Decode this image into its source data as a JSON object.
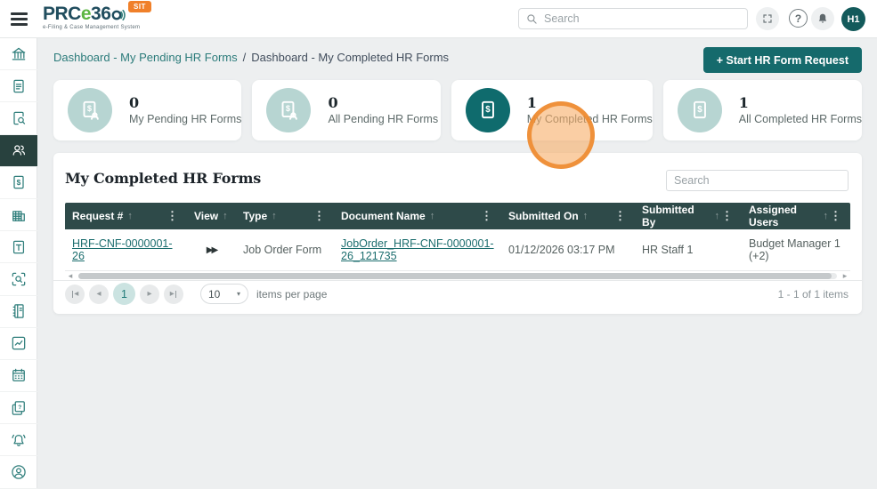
{
  "header": {
    "logo": {
      "prc": "PRC",
      "e": "e",
      "num": "36",
      "tagline": "e-Filing & Case Management System",
      "badge": "SIT"
    },
    "search_placeholder": "Search",
    "avatar": "H1"
  },
  "breadcrumb": {
    "link": "Dashboard - My Pending HR Forms",
    "separator": "/",
    "current": "Dashboard - My Completed HR Forms"
  },
  "toolbar": {
    "start_button": "+ Start HR Form Request"
  },
  "stats": [
    {
      "value": "0",
      "label": "My Pending HR Forms"
    },
    {
      "value": "0",
      "label": "All Pending HR Forms"
    },
    {
      "value": "1",
      "label": "My Completed HR Forms"
    },
    {
      "value": "1",
      "label": "All Completed HR Forms"
    }
  ],
  "panel": {
    "title": "My Completed HR Forms",
    "search_placeholder": "Search",
    "columns": [
      "Request #",
      "View",
      "Type",
      "Document Name",
      "Submitted On",
      "Submitted By",
      "Assigned Users"
    ],
    "row": {
      "request_id": "HRF-CNF-0000001-26",
      "type": "Job Order Form",
      "document_name": "JobOrder_HRF-CNF-0000001-26_121735",
      "submitted_on": "01/12/2026 03:17 PM",
      "submitted_by": "HR Staff 1",
      "assigned_users": "Budget Manager 1 (+2)"
    },
    "pagination": {
      "page": "1",
      "page_size": "10",
      "items_per_page": "items per page",
      "range": "1 - 1 of 1 items"
    }
  },
  "icons": {
    "sort": "↑",
    "kebab": "⋮",
    "help": "?",
    "view_forward": "▶▶",
    "prev": "◂",
    "next": "▸",
    "caret_down": "▾",
    "dollar": "$",
    "question": "?"
  },
  "colors": {
    "accent": "#156a6c",
    "grid_header": "#2e4a49",
    "highlight": "#ee8c30",
    "badge": "#f0802a"
  }
}
